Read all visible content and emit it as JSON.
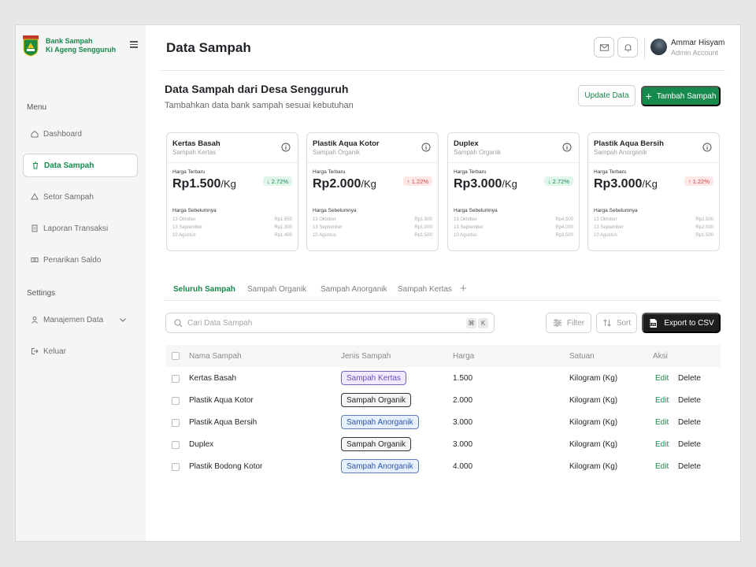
{
  "sidebar": {
    "brand_line1": "Bank Sampah",
    "brand_line2": "Ki Ageng Sengguruh",
    "menu_label": "Menu",
    "settings_label": "Settings",
    "items": [
      {
        "label": "Dashboard",
        "icon": "home-icon"
      },
      {
        "label": "Data Sampah",
        "icon": "trash-icon",
        "active": true
      },
      {
        "label": "Setor Sampah",
        "icon": "recycle-icon"
      },
      {
        "label": "Laporan Transaksi",
        "icon": "report-icon"
      },
      {
        "label": "Penarikan Saldo",
        "icon": "cash-icon"
      }
    ],
    "settings_items": [
      {
        "label": "Manajemen Data",
        "icon": "user-icon"
      },
      {
        "label": "Keluar",
        "icon": "logout-icon"
      }
    ]
  },
  "header": {
    "title": "Data Sampah",
    "user_name": "Ammar Hisyam",
    "user_role": "Admin Account"
  },
  "section": {
    "title": "Data Sampah dari Desa Sengguruh",
    "subtitle": "Tambahkan data bank sampah sesuai kebutuhan",
    "update_label": "Update Data",
    "add_label": "Tambah Sampah"
  },
  "cards": [
    {
      "name": "Kertas Basah",
      "category": "Sampah Kertas",
      "latest_label": "Harga Terbaru",
      "price": "Rp1.500",
      "unit": "/Kg",
      "change": "↓ 2.72%",
      "trend": "down",
      "prev_label": "Harga Sebelumnya",
      "history": [
        {
          "date": "13 Oktober",
          "price": "Rp1.650"
        },
        {
          "date": "13 September",
          "price": "Rp1.300"
        },
        {
          "date": "10 Agustus",
          "price": "Rp1.400"
        }
      ]
    },
    {
      "name": "Plastik Aqua Kotor",
      "category": "Sampah Organik",
      "latest_label": "Harga Terbaru",
      "price": "Rp2.000",
      "unit": "/Kg",
      "change": "↑ 1.22%",
      "trend": "up",
      "prev_label": "Harga Sebelumnya",
      "history": [
        {
          "date": "13 Oktober",
          "price": "Rp1.500"
        },
        {
          "date": "13 September",
          "price": "Rp1.000"
        },
        {
          "date": "10 Agustus",
          "price": "Rp1.500"
        }
      ]
    },
    {
      "name": "Duplex",
      "category": "Sampah Organik",
      "latest_label": "Harga Terbaru",
      "price": "Rp3.000",
      "unit": "/Kg",
      "change": "↓ 2.72%",
      "trend": "down",
      "prev_label": "Harga Sebelumnya",
      "history": [
        {
          "date": "13 Oktober",
          "price": "Rp4.500"
        },
        {
          "date": "13 September",
          "price": "Rp4.000"
        },
        {
          "date": "10 Agustus",
          "price": "Rp3.500"
        }
      ]
    },
    {
      "name": "Plastik Aqua Bersih",
      "category": "Sampah Anorganik",
      "latest_label": "Harga Terbaru",
      "price": "Rp3.000",
      "unit": "/Kg",
      "change": "↑ 1.22%",
      "trend": "up",
      "prev_label": "Harga Sebelumnya",
      "history": [
        {
          "date": "13 Oktober",
          "price": "Rp2.500"
        },
        {
          "date": "13 September",
          "price": "Rp2.000"
        },
        {
          "date": "10 Agustus",
          "price": "Rp1.500"
        }
      ]
    }
  ],
  "tabs": [
    {
      "label": "Seluruh Sampah",
      "active": true
    },
    {
      "label": "Sampah Organik"
    },
    {
      "label": "Sampah Anorganik"
    },
    {
      "label": "Sampah Kertas"
    }
  ],
  "tab_add": "+",
  "toolbar": {
    "search_placeholder": "Cari Data Sampah",
    "shortcut_mod": "⌘",
    "shortcut_key": "K",
    "filter_label": "Filter",
    "sort_label": "Sort",
    "export_label": "Export to CSV"
  },
  "table": {
    "columns": [
      "Nama Sampah",
      "Jenis Sampah",
      "Harga",
      "Satuan",
      "Aksi"
    ],
    "edit_label": "Edit",
    "delete_label": "Delete",
    "rows": [
      {
        "name": "Kertas Basah",
        "type": "Sampah Kertas",
        "type_key": "kertas",
        "price": "1.500",
        "unit": "Kilogram (Kg)"
      },
      {
        "name": "Plastik Aqua Kotor",
        "type": "Sampah Organik",
        "type_key": "organik",
        "price": "2.000",
        "unit": "Kilogram (Kg)"
      },
      {
        "name": "Plastik Aqua Bersih",
        "type": "Sampah Anorganik",
        "type_key": "anorganik",
        "price": "3.000",
        "unit": "Kilogram (Kg)"
      },
      {
        "name": "Duplex",
        "type": "Sampah Organik",
        "type_key": "organik",
        "price": "3.000",
        "unit": "Kilogram (Kg)"
      },
      {
        "name": "Plastik Bodong Kotor",
        "type": "Sampah Anorganik",
        "type_key": "anorganik",
        "price": "4.000",
        "unit": "Kilogram (Kg)"
      }
    ]
  },
  "colors": {
    "brand": "#16894d",
    "up": "#d64545",
    "down": "#16894d"
  }
}
